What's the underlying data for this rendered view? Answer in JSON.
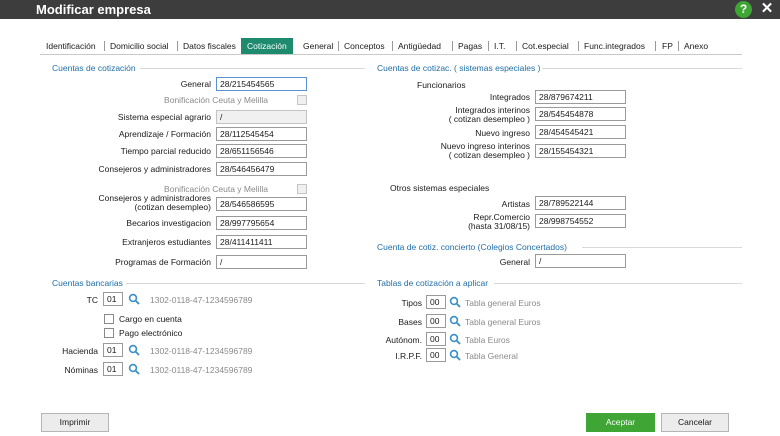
{
  "window": {
    "title": "Modificar empresa",
    "help_glyph": "?",
    "close_glyph": "✕"
  },
  "tabs": [
    {
      "label": "Identificación"
    },
    {
      "label": "Domicilio social"
    },
    {
      "label": "Datos fiscales"
    },
    {
      "label": "Cotización",
      "active": true
    },
    {
      "label": "General"
    },
    {
      "label": "Conceptos"
    },
    {
      "label": "Antigüedad"
    },
    {
      "label": "Pagas"
    },
    {
      "label": "I.T."
    },
    {
      "label": "Cot.especial"
    },
    {
      "label": "Func.integrados"
    },
    {
      "label": "FP"
    },
    {
      "label": "Anexo"
    }
  ],
  "cuentas_cotizacion": {
    "header": "Cuentas de cotización",
    "general_label": "General",
    "general_value": "28/215454565",
    "bonificacion_label": "Bonificación Ceuta y Melilla",
    "agrario_label": "Sistema especial agrario",
    "agrario_value": "/",
    "aprendizaje_label": "Aprendizaje / Formación",
    "aprendizaje_value": "28/112545454",
    "parcial_label": "Tiempo parcial reducido",
    "parcial_value": "28/651156546",
    "consejeros_label": "Consejeros y administradores",
    "consejeros_value": "28/546456479",
    "bonificacion2_label": "Bonificación Ceuta y Melilla",
    "consejeros_desempleo_label_1": "Consejeros  y administradores",
    "consejeros_desempleo_label_2": "(cotizan desempleo)",
    "consejeros_desempleo_value": "28/546586595",
    "becarios_label": "Becarios investigacion",
    "becarios_value": "28/997795654",
    "extranjeros_label": "Extranjeros estudiantes",
    "extranjeros_value": "28/411411411",
    "programas_label": "Programas de Formación",
    "programas_value": "/"
  },
  "cuentas_especiales": {
    "header": "Cuentas de cotizac. ( sistemas especiales )",
    "funcionarios_label": "Funcionarios",
    "integrados_label": "Integrados",
    "integrados_value": "28/879674211",
    "integrados_interinos_label_1": "Integrados interinos",
    "integrados_interinos_label_2": "( cotizan desempleo )",
    "integrados_interinos_value": "28/545454878",
    "nuevo_ingreso_label": "Nuevo ingreso",
    "nuevo_ingreso_value": "28/454545421",
    "nuevo_interino_label_1": "Nuevo ingreso interinos",
    "nuevo_interino_label_2": "( cotizan desempleo )",
    "nuevo_interino_value": "28/155454321",
    "otros_label": "Otros sistemas especiales",
    "artistas_label": "Artistas",
    "artistas_value": "28/789522144",
    "repr_label_1": "Repr.Comercio",
    "repr_label_2": "(hasta 31/08/15)",
    "repr_value": "28/998754552"
  },
  "concierto": {
    "header": "Cuenta de cotiz. concierto (Colegios Concertados)",
    "general_label": "General",
    "general_value": "/"
  },
  "bancarias": {
    "header": "Cuentas bancarias",
    "tc_label": "TC",
    "tc_code": "01",
    "tc_account": "1302-0118-47-1234596789",
    "cargo_label": "Cargo en cuenta",
    "pago_label": "Pago electrónico",
    "hacienda_label": "Hacienda",
    "hacienda_code": "01",
    "hacienda_account": "1302-0118-47-1234596789",
    "nominas_label": "Nóminas",
    "nominas_code": "01",
    "nominas_account": "1302-0118-47-1234596789"
  },
  "tablas": {
    "header": "Tablas de cotización a aplicar",
    "tipos_label": "Tipos",
    "tipos_code": "00",
    "tipos_name": "Tabla general Euros",
    "bases_label": "Bases",
    "bases_code": "00",
    "bases_name": "Tabla general Euros",
    "autonom_label": "Autónom.",
    "autonom_code": "00",
    "autonom_name": "Tabla Euros",
    "irpf_label": "I.R.P.F.",
    "irpf_code": "00",
    "irpf_name": "Tabla General"
  },
  "buttons": {
    "imprimir": "Imprimir",
    "aceptar": "Aceptar",
    "cancelar": "Cancelar"
  },
  "colors": {
    "accent": "#1e8a6e",
    "section": "#1e6fa8",
    "primary_button": "#3fa535",
    "titlebar": "#3d3d3d"
  }
}
